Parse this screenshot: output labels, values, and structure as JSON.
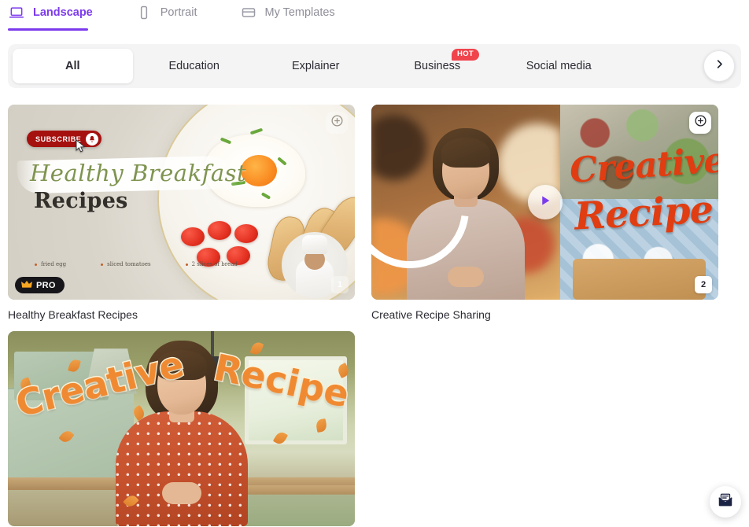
{
  "orientation_tabs": [
    {
      "label": "Landscape",
      "icon": "laptop-icon",
      "active": true
    },
    {
      "label": "Portrait",
      "icon": "phone-icon",
      "active": false
    },
    {
      "label": "My Templates",
      "icon": "folder-icon",
      "active": false
    }
  ],
  "categories": [
    {
      "label": "All",
      "active": true,
      "badge": null
    },
    {
      "label": "Education",
      "active": false,
      "badge": null
    },
    {
      "label": "Explainer",
      "active": false,
      "badge": null
    },
    {
      "label": "Business",
      "active": false,
      "badge": "HOT"
    },
    {
      "label": "Social media",
      "active": false,
      "badge": null
    }
  ],
  "next_arrow_icon": "chevron-right-icon",
  "templates": [
    {
      "title": "Healthy Breakfast Recipes",
      "scene_script": "Healthy Breakfast",
      "scene_heading": "Recipes",
      "subscribe_label": "SUBSCRIBE",
      "pro_label": "PRO",
      "scene_count": "1",
      "add_icon": "plus-icon",
      "ingredients": [
        "fried egg",
        "sliced tomatoes",
        "2 slices of bread"
      ]
    },
    {
      "title": "Creative Recipe Sharing",
      "overlay_line1": "Creative",
      "overlay_line2": "Recipe",
      "scene_count": "2",
      "add_icon": "plus-icon",
      "play_icon": "play-icon"
    },
    {
      "title": "",
      "overlay_line1": "Creative",
      "overlay_line2": "Recipe"
    }
  ],
  "chat_widget": {
    "icon": "message-envelope-icon"
  },
  "colors": {
    "accent_purple": "#7c3aed",
    "hot_red": "#f0444c",
    "subscribe_red": "#a5110f",
    "pro_black": "#16161a",
    "pro_crown_gold": "#f5a623",
    "overlay_orange": "#e03d12",
    "bubble_orange": "#f08a32",
    "filter_bar_gray": "#f4f4f5"
  }
}
